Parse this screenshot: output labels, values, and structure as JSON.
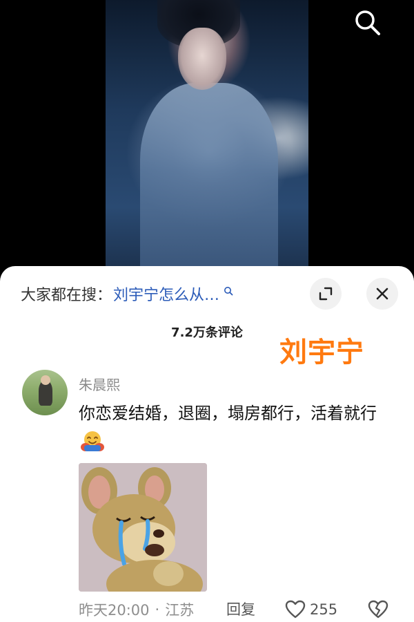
{
  "search": {
    "prefix": "大家都在搜：",
    "query": "刘宇宁怎么从…"
  },
  "comments": {
    "count_label": "7.2万条评论"
  },
  "watermark": "刘宇宁",
  "comment": {
    "username": "朱晨熙",
    "text": "你恋爱结婚，退圈，塌房都行，活着就行",
    "emoji": "hugging-face-emoji",
    "time": "昨天20:00",
    "location": "江苏",
    "reply_label": "回复",
    "like_count": "255"
  },
  "colors": {
    "accent_link": "#2b5bb8",
    "watermark": "#ff7a10"
  }
}
